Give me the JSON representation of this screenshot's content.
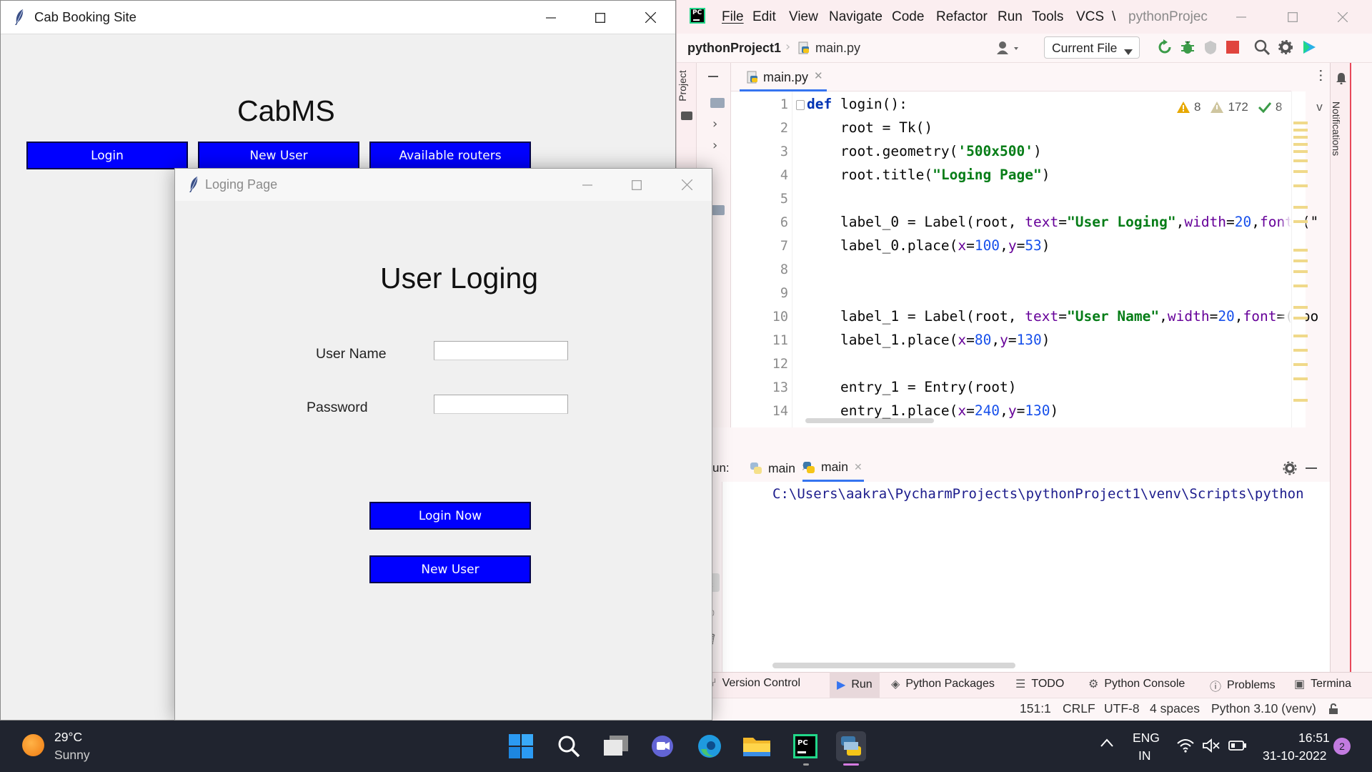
{
  "cab_window": {
    "title": "Cab Booking Site",
    "heading": "CabMS",
    "buttons": {
      "login": "Login",
      "new_user": "New User",
      "available_routers": "Available routers"
    }
  },
  "login_window": {
    "title": "Loging Page",
    "heading": "User Loging",
    "user_name_label": "User Name",
    "password_label": "Password",
    "user_name_value": "",
    "password_value": "",
    "login_now_button": "Login Now",
    "new_user_button": "New User",
    "button_color": "#0000ff"
  },
  "pycharm": {
    "menu": [
      "File",
      "Edit",
      "View",
      "Navigate",
      "Code",
      "Refactor",
      "Run",
      "Tools",
      "VCS",
      "\\"
    ],
    "project_title": "pythonProjec",
    "breadcrumb": {
      "project": "pythonProject1",
      "file": "main.py"
    },
    "run_config": "Current File",
    "side_tab": "Project",
    "notifications_tab": "Notifications",
    "editor_tab": "main.py",
    "inspections": {
      "warnings": "8",
      "weak_warnings": "172",
      "ok": "8"
    },
    "line_numbers": [
      "1",
      "2",
      "3",
      "4",
      "5",
      "6",
      "7",
      "8",
      "9",
      "10",
      "11",
      "12",
      "13",
      "14"
    ],
    "code": {
      "l1_kw": "def",
      "l1_rest": " login():",
      "l2": "    root = Tk()",
      "l3_a": "    root.geometry(",
      "l3_s": "'500x500'",
      "l3_b": ")",
      "l4_a": "    root.title(",
      "l4_s": "\"Loging Page\"",
      "l4_b": ")",
      "l6_a": "    label_0 = Label(root, ",
      "l6_p1": "text",
      "l6_eq1": "=",
      "l6_s": "\"User Loging\"",
      "l6_c1": ",",
      "l6_p2": "width",
      "l6_eq2": "=",
      "l6_n": "20",
      "l6_c2": ",",
      "l6_p3": "font",
      "l6_tail": "=(\"",
      "l7_a": "    label_0.place(",
      "l7_p1": "x",
      "l7_eq1": "=",
      "l7_n1": "100",
      "l7_c": ",",
      "l7_p2": "y",
      "l7_eq2": "=",
      "l7_n2": "53",
      "l7_b": ")",
      "l10_a": "    label_1 = Label(root, ",
      "l10_p1": "text",
      "l10_eq1": "=",
      "l10_s": "\"User Name\"",
      "l10_c1": ",",
      "l10_p2": "width",
      "l10_eq2": "=",
      "l10_n": "20",
      "l10_c2": ",",
      "l10_p3": "font",
      "l10_tail": "=(\"bo",
      "l11_a": "    label_1.place(",
      "l11_p1": "x",
      "l11_eq1": "=",
      "l11_n1": "80",
      "l11_c": ",",
      "l11_p2": "y",
      "l11_eq2": "=",
      "l11_n2": "130",
      "l11_b": ")",
      "l13": "    entry_1 = Entry(root)",
      "l14_a": "    entry_1.place(",
      "l14_p1": "x",
      "l14_eq1": "=",
      "l14_n1": "240",
      "l14_c": ",",
      "l14_p2": "y",
      "l14_eq2": "=",
      "l14_n2": "130",
      "l14_b": ")"
    },
    "run_panel": {
      "label": "un:",
      "tab1": "main",
      "tab2": "main",
      "console_line": "C:\\Users\\aakra\\PycharmProjects\\pythonProject1\\venv\\Scripts\\python"
    },
    "bottom_tabs": [
      "Version Control",
      "Run",
      "Python Packages",
      "TODO",
      "Python Console",
      "Problems",
      "Termina"
    ],
    "status": {
      "position": "151:1",
      "line_sep": "CRLF",
      "encoding": "UTF-8",
      "indent": "4 spaces",
      "interpreter": "Python 3.10 (venv)"
    }
  },
  "taskbar": {
    "weather_temp": "29°C",
    "weather_desc": "Sunny",
    "lang_top": "ENG",
    "lang_bottom": "IN",
    "time": "16:51",
    "date": "31-10-2022",
    "notification_count": "2"
  }
}
